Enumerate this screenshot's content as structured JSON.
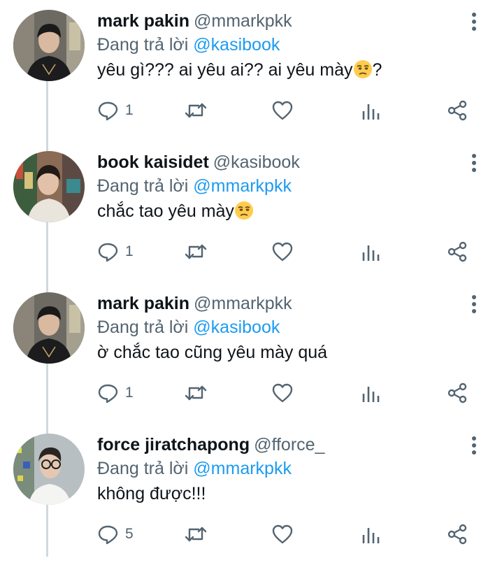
{
  "thread": {
    "reply_prefix": "Đang trả lời"
  },
  "tweets": [
    {
      "name": "mark pakin",
      "handle": "@mmarkpkk",
      "reply_to": "@kasibook",
      "text": "yêu gì??? ai yêu ai?? ai yêu mày",
      "text_suffix": "?",
      "emoji": "unamused-face",
      "reply_count": "1"
    },
    {
      "name": "book kaisidet",
      "handle": "@kasibook",
      "reply_to": "@mmarkpkk",
      "text": "chắc tao yêu mày",
      "text_suffix": "",
      "emoji": "unamused-face",
      "reply_count": "1"
    },
    {
      "name": "mark pakin",
      "handle": "@mmarkpkk",
      "reply_to": "@kasibook",
      "text": "ờ chắc tao cũng yêu mày quá",
      "text_suffix": "",
      "emoji": "",
      "reply_count": "1"
    },
    {
      "name": "force jiratchapong",
      "handle": "@fforce_",
      "reply_to": "@mmarkpkk",
      "text": "không được!!!",
      "text_suffix": "",
      "emoji": "",
      "reply_count": "5"
    }
  ],
  "icons": {
    "reply": "reply-bubble-icon",
    "retweet": "retweet-icon",
    "like": "heart-icon",
    "analytics": "analytics-icon",
    "share": "share-icon",
    "more": "more-vertical-icon"
  },
  "colors": {
    "mention": "#1d9bf0",
    "secondary_text": "#536471",
    "thread_line": "#cfd9de"
  }
}
